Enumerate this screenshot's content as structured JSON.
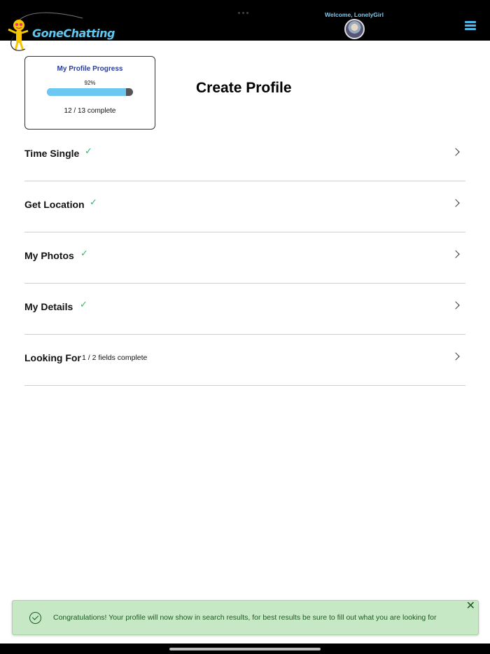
{
  "header": {
    "logo_text": "GoneChatting",
    "welcome": "Welcome, LonelyGirl"
  },
  "progress": {
    "title": "My Profile Progress",
    "percent_label": "92%",
    "percent_value": 0.92,
    "count": "12 / 13 complete"
  },
  "page_title": "Create Profile",
  "sections": [
    {
      "label": "Time Single",
      "status": "✓"
    },
    {
      "label": "Get Location",
      "status": "✓"
    },
    {
      "label": "My Photos",
      "status": "✓"
    },
    {
      "label": "My Details",
      "status": "✓"
    },
    {
      "label": "Looking For",
      "status_text": "1 / 2 fields complete"
    }
  ],
  "toast": {
    "message": "Congratulations! Your profile will now show in search results, for best results be sure to fill out what you are looking for",
    "close": "✕"
  },
  "colors": {
    "accent": "#4cb8ee",
    "check": "#2db86c",
    "toast_bg": "#c7e8c4",
    "toast_text": "#1d5a23"
  }
}
